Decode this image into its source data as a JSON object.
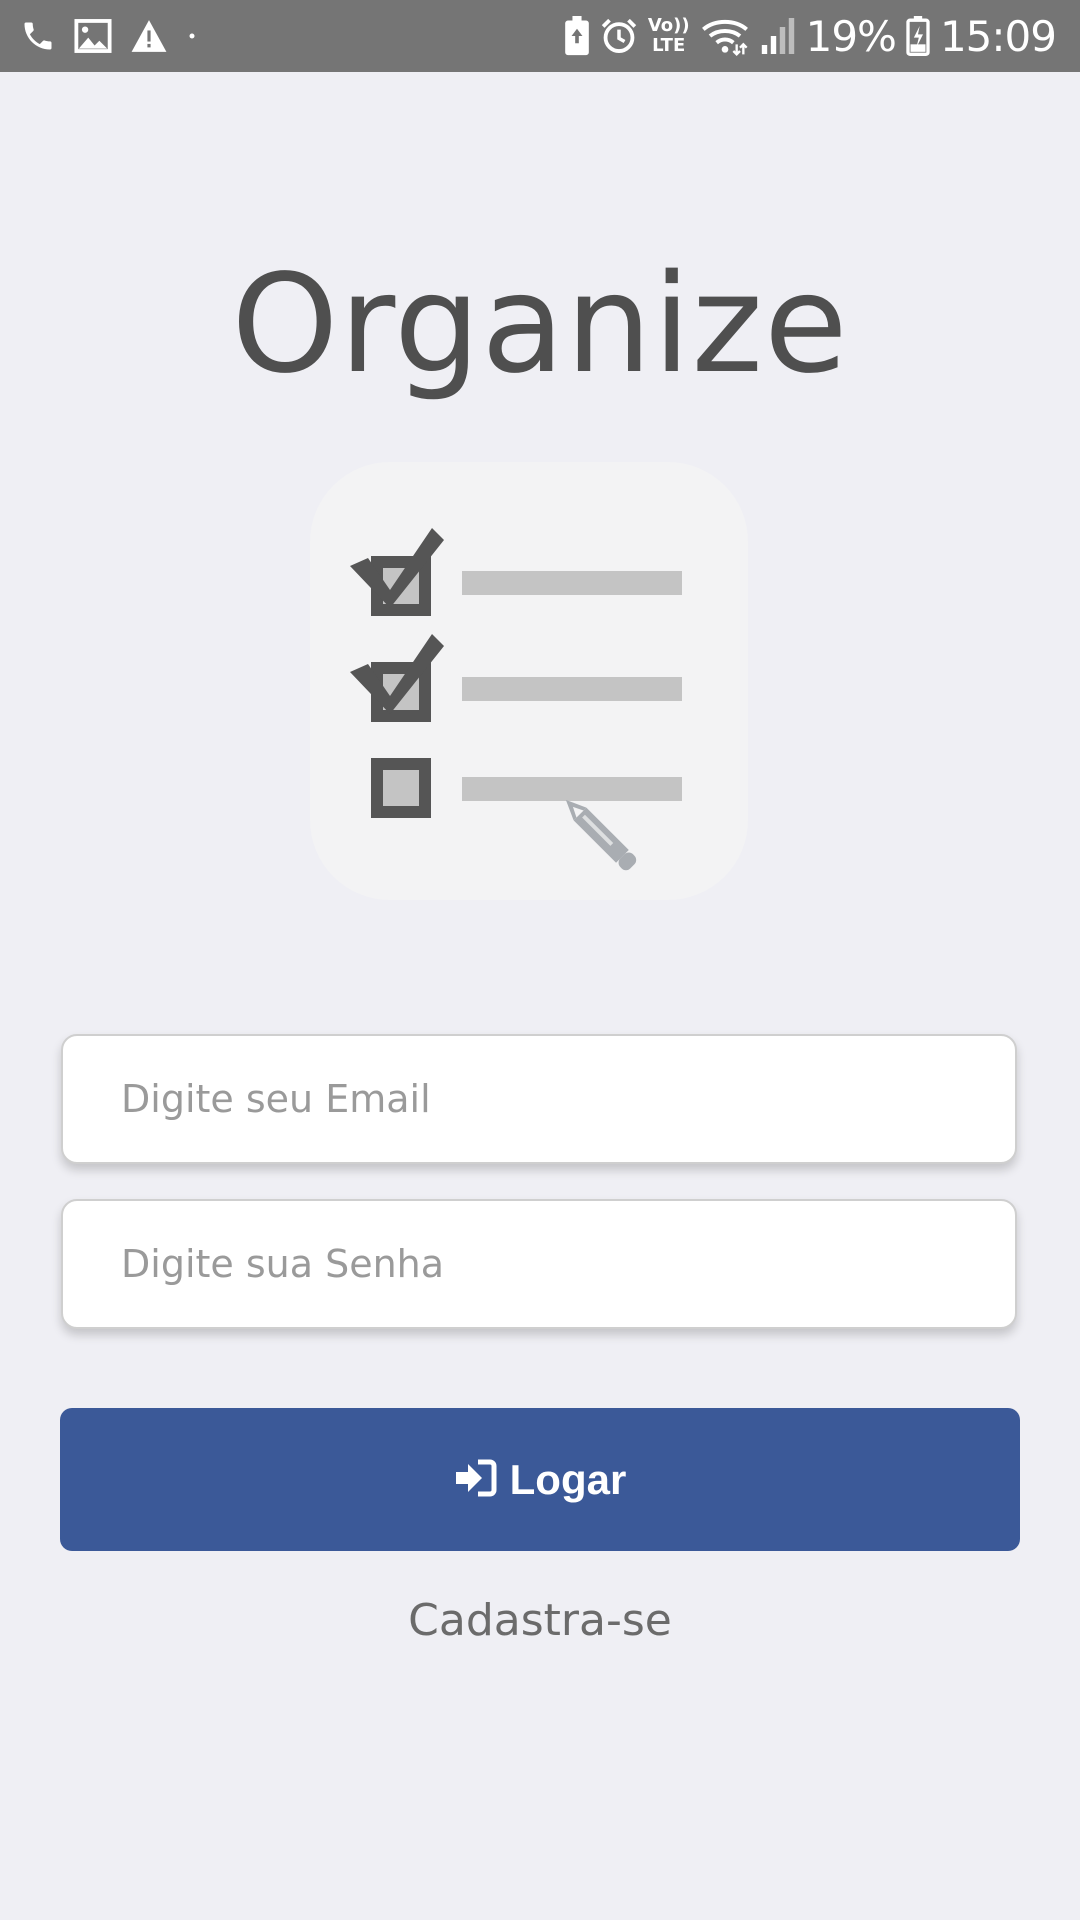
{
  "status_bar": {
    "battery_percent": "19%",
    "time": "15:09",
    "volte_label_top": "Vo))",
    "volte_label_bottom": "LTE",
    "left_icons": [
      "phone-icon",
      "image-icon",
      "warning-icon",
      "dot-icon"
    ],
    "right_icons": [
      "battery-saver-icon",
      "alarm-icon",
      "volte-icon",
      "wifi-icon",
      "signal-icon",
      "battery-charging-icon"
    ]
  },
  "app": {
    "title": "Organize",
    "logo_icon": "checklist-icon"
  },
  "form": {
    "email_placeholder": "Digite seu Email",
    "email_value": "",
    "password_placeholder": "Digite sua Senha",
    "password_value": "",
    "login_label": "Logar",
    "login_icon": "sign-in-icon",
    "signup_label": "Cadastra-se"
  },
  "colors": {
    "background": "#efeff4",
    "status_bar": "#757575",
    "title": "#4f4f4f",
    "primary_button": "#3b5998",
    "link": "#6b6b6b"
  }
}
